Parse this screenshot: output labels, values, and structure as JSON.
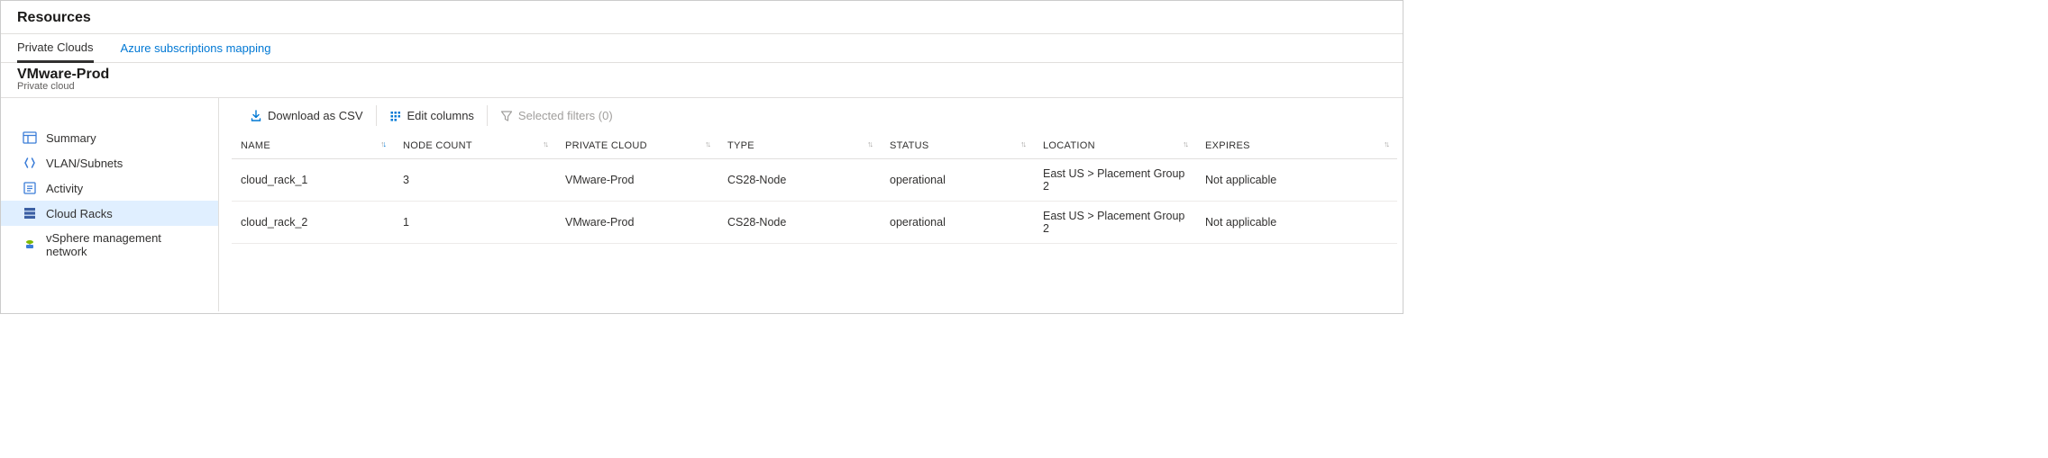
{
  "header": {
    "title": "Resources"
  },
  "tabs": {
    "private_clouds": "Private Clouds",
    "azure_mapping": "Azure subscriptions mapping"
  },
  "subheader": {
    "title": "VMware-Prod",
    "subtitle": "Private cloud"
  },
  "sidebar": {
    "summary": "Summary",
    "vlan": "VLAN/Subnets",
    "activity": "Activity",
    "cloud_racks": "Cloud Racks",
    "vsphere": "vSphere management network"
  },
  "toolbar": {
    "download_csv": "Download as CSV",
    "edit_columns": "Edit columns",
    "selected_filters": "Selected filters (0)"
  },
  "columns": {
    "name": "NAME",
    "node_count": "NODE COUNT",
    "private_cloud": "PRIVATE CLOUD",
    "type": "TYPE",
    "status": "STATUS",
    "location": "LOCATION",
    "expires": "EXPIRES"
  },
  "rows": [
    {
      "name": "cloud_rack_1",
      "node_count": "3",
      "private_cloud": "VMware-Prod",
      "type": "CS28-Node",
      "status": "operational",
      "location": "East US > Placement Group 2",
      "expires": "Not applicable"
    },
    {
      "name": "cloud_rack_2",
      "node_count": "1",
      "private_cloud": "VMware-Prod",
      "type": "CS28-Node",
      "status": "operational",
      "location": "East US > Placement Group 2",
      "expires": "Not applicable"
    }
  ]
}
